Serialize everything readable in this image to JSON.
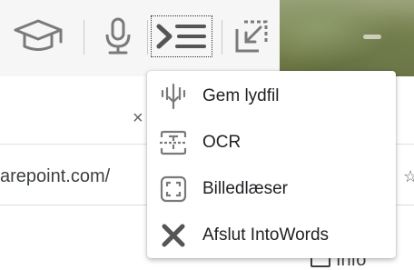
{
  "toolbar": {
    "buttons": [
      {
        "icon": "graduation-cap-icon"
      },
      {
        "icon": "microphone-icon"
      },
      {
        "icon": "reading-menu-icon",
        "active": true
      },
      {
        "icon": "screenshot-capture-icon"
      }
    ]
  },
  "browser": {
    "tab_close": "×",
    "address_text": "arepoint.com/",
    "star_glyph": "☆",
    "info_label": "Info"
  },
  "menu": {
    "items": [
      {
        "label": "Gem lydfil",
        "icon": "save-audio-icon"
      },
      {
        "label": "OCR",
        "icon": "ocr-icon"
      },
      {
        "label": "Billedlæser",
        "icon": "image-reader-icon"
      },
      {
        "label": "Afslut IntoWords",
        "icon": "close-icon"
      }
    ]
  },
  "colors": {
    "icon_gray": "#7a7a7a",
    "icon_dark": "#555555",
    "menu_text": "#202124",
    "toolbar_bg": "#f6f6f6"
  }
}
